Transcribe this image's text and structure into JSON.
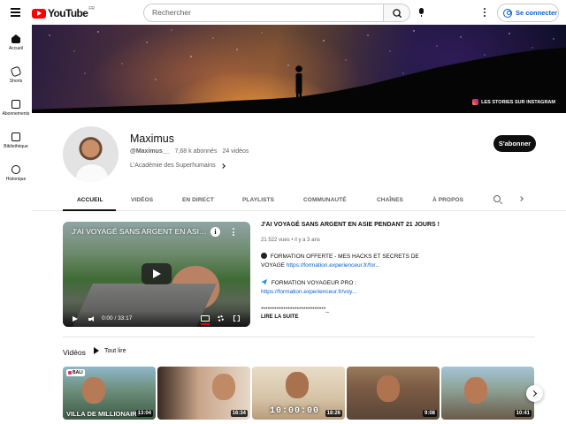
{
  "header": {
    "logo_text": "YouTube",
    "logo_country": "FR",
    "search_placeholder": "Rechercher",
    "signin_label": "Se connecter"
  },
  "sidebar": {
    "items": [
      {
        "label": "Accueil",
        "icon": "home-icon"
      },
      {
        "label": "Shorts",
        "icon": "shorts-icon"
      },
      {
        "label": "Abonnements",
        "icon": "subscriptions-icon"
      },
      {
        "label": "Bibliothèque",
        "icon": "library-icon"
      },
      {
        "label": "Historique",
        "icon": "history-icon"
      }
    ]
  },
  "banner": {
    "link_label": "LES STORIES SUR INSTAGRAM"
  },
  "channel": {
    "name": "Maximus",
    "handle": "@Maximus__",
    "subscribers": "7,68 k abonnés",
    "videos": "24 vidéos",
    "tagline": "L'Académie des Superhumains",
    "subscribe_label": "S'abonner"
  },
  "tabs": [
    "ACCUEIL",
    "VIDÉOS",
    "EN DIRECT",
    "PLAYLISTS",
    "COMMUNAUTÉ",
    "CHAÎNES",
    "À PROPOS"
  ],
  "featured": {
    "player_title": "J'AI VOYAGÉ SANS ARGENT EN ASIE PENDANT 21 JOURS !",
    "time": "0:00 / 33:17",
    "title": "J'AI VOYAGÉ SANS ARGENT EN ASIE PENDANT 21 JOURS !",
    "views": "21 522 vues",
    "age": "il y a 3 ans",
    "desc_line1": "FORMATION OFFERTE - MES HACKS ET SECRETS DE VOYAGE",
    "desc_link1": "https://formation.experienceur.fr/for...",
    "desc_line2": "FORMATION VOYAGEUR PRO :",
    "desc_link2": "https://formation.experienceur.fr/voy...",
    "desc_line3": "*****************************_",
    "read_more": "LIRE LA SUITE"
  },
  "shelf": {
    "title": "Vidéos",
    "play_all": "Tout lire",
    "videos": [
      {
        "duration": "13:04",
        "overlay": "VILLA DE MILLIONAIRE",
        "badge": "BALI"
      },
      {
        "duration": "16:34"
      },
      {
        "duration": "18:26",
        "overlay": "10:00:00"
      },
      {
        "duration": "9:08"
      },
      {
        "duration": "10:41"
      }
    ]
  },
  "colors": {
    "brand_red": "#ff0000",
    "link_blue": "#065fd4",
    "text_primary": "#0f0f0f",
    "text_secondary": "#606060"
  }
}
